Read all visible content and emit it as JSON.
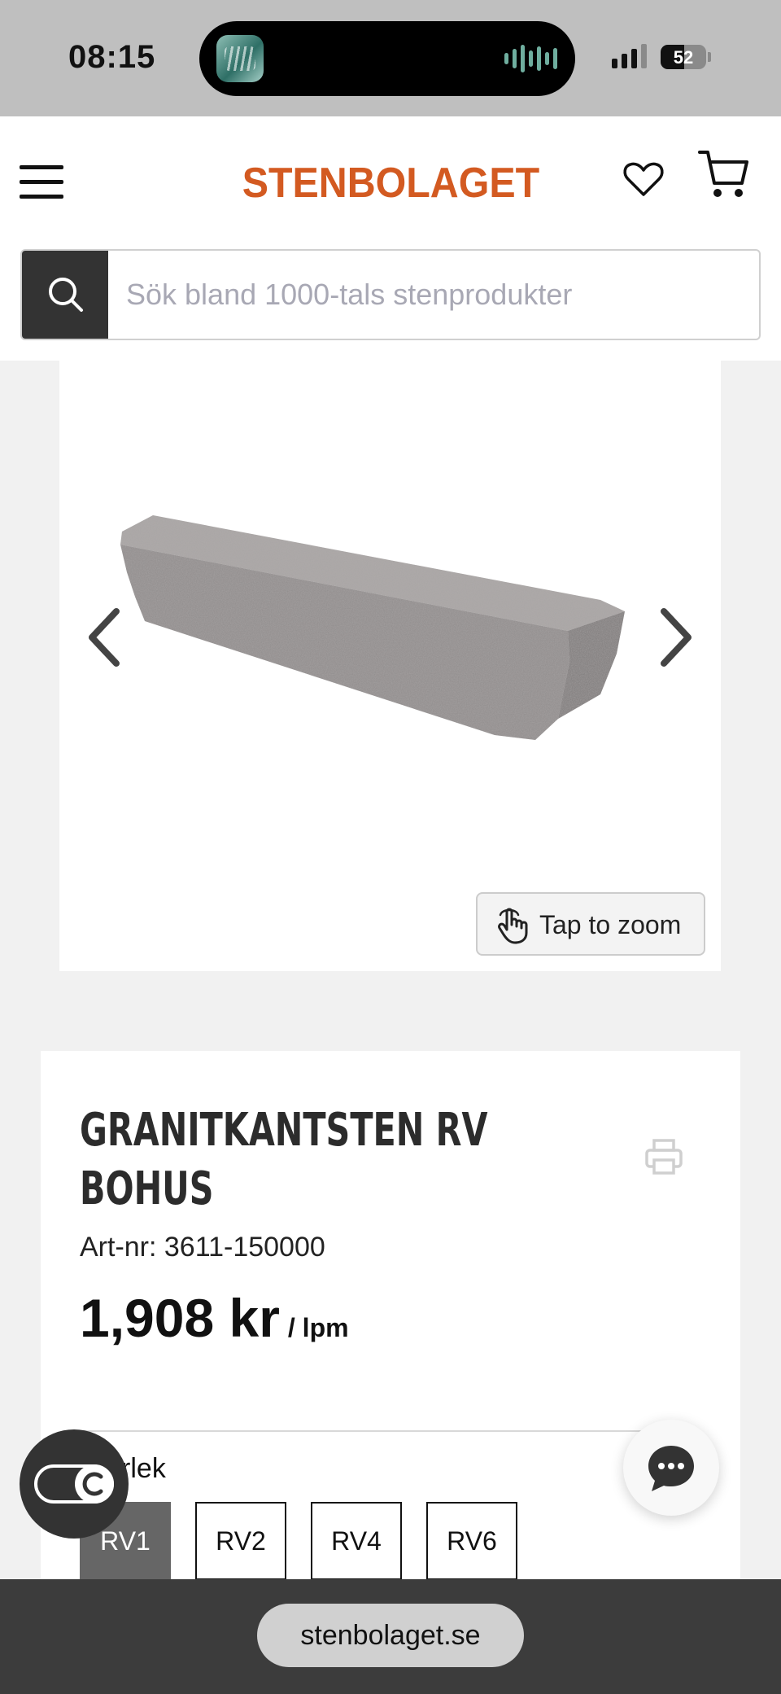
{
  "status_bar": {
    "time": "08:15",
    "battery_percent": "52",
    "battery_level": 0.52,
    "signal_bars_filled": 3
  },
  "header": {
    "logo": "STENBOLAGET",
    "brand_color": "#d35a21",
    "search": {
      "placeholder": "Sök bland 1000-tals stenprodukter"
    }
  },
  "gallery": {
    "zoom_label": "Tap to zoom"
  },
  "product": {
    "title_line1": "GRANITKANTSTEN RV",
    "title_line2": "BOHUS",
    "art_nr": "Art-nr: 3611-150000",
    "price": "1,908 kr",
    "price_unit": "/ lpm",
    "size_label": "Storlek",
    "sizes": [
      "RV1",
      "RV2",
      "RV4",
      "RV6"
    ],
    "selected_size": "RV1"
  },
  "browser": {
    "url": "stenbolaget.se"
  },
  "icons": {
    "menu": "hamburger-icon",
    "favorites": "heart-icon",
    "cart": "cart-icon",
    "search": "search-icon",
    "prev": "chevron-left-icon",
    "next": "chevron-right-icon",
    "zoom": "hand-pointer-icon",
    "print": "printer-icon",
    "cookie": "cookie-toggle-icon",
    "chat": "chat-bubble-icon"
  }
}
